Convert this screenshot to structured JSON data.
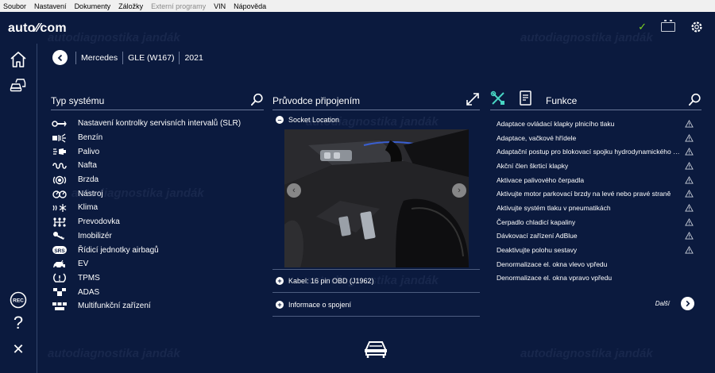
{
  "menubar": {
    "items": [
      {
        "label": "Soubor"
      },
      {
        "label": "Nastavení"
      },
      {
        "label": "Dokumenty"
      },
      {
        "label": "Záložky"
      },
      {
        "label": "Externí programy",
        "disabled": true
      },
      {
        "label": "VIN"
      },
      {
        "label": "Nápověda"
      }
    ]
  },
  "app": {
    "logo": "auto⁄⁄com",
    "status_check": "✓"
  },
  "breadcrumb": {
    "make": "Mercedes",
    "model": "GLE (W167)",
    "year": "2021"
  },
  "systems": {
    "title": "Typ systému",
    "items": [
      {
        "label": "Nastavení kontrolky servisních intervalů (SLR)",
        "icon": "wrench-icon"
      },
      {
        "label": "Benzín",
        "icon": "fuel-injector-icon"
      },
      {
        "label": "Palivo",
        "icon": "fuel-icon"
      },
      {
        "label": "Nafta",
        "icon": "diesel-icon"
      },
      {
        "label": "Brzda",
        "icon": "brake-icon"
      },
      {
        "label": "Nástroj",
        "icon": "instrument-icon"
      },
      {
        "label": "Klima",
        "icon": "climate-icon"
      },
      {
        "label": "Prevodovka",
        "icon": "gearbox-icon"
      },
      {
        "label": "Imobilizér",
        "icon": "key-icon"
      },
      {
        "label": "Řídicí jednotky airbagů",
        "icon": "srs-icon"
      },
      {
        "label": "EV",
        "icon": "ev-icon"
      },
      {
        "label": "TPMS",
        "icon": "tpms-icon"
      },
      {
        "label": "ADAS",
        "icon": "adas-icon"
      },
      {
        "label": "Multifunkční zařízení",
        "icon": "multifunction-icon"
      }
    ],
    "srs_badge": "SRS"
  },
  "guide": {
    "title": "Průvodce připojením",
    "socket_label": "Socket Location",
    "cable_label": "Kabel: 16 pin OBD (J1962)",
    "info_label": "Informace o spojení"
  },
  "functions": {
    "title": "Funkce",
    "items": [
      {
        "label": "Adaptace ovládací klapky plnicího tlaku"
      },
      {
        "label": "Adaptace, vačkové hřídele"
      },
      {
        "label": "Adaptační postup pro blokovací spojku hydrodynamického měni..."
      },
      {
        "label": "Akční člen škrticí klapky"
      },
      {
        "label": "Aktivace palivového čerpadla"
      },
      {
        "label": "Aktivujte motor parkovací brzdy na levé nebo pravé straně"
      },
      {
        "label": "Aktivujte systém tlaku v pneumatikách"
      },
      {
        "label": "Čerpadlo chladicí kapaliny"
      },
      {
        "label": "Dávkovací zařízení AdBlue"
      },
      {
        "label": "Deaktivujte polohu sestavy"
      },
      {
        "label": "Denormalizace el. okna vlevo vpředu"
      },
      {
        "label": "Denormalizace el. okna vpravo vpředu"
      }
    ],
    "next_label": "Další"
  },
  "sidebar": {
    "rec_label": "REC",
    "help_label": "?",
    "close_label": "✕"
  },
  "watermark": {
    "text": "autodiagnostika jandák"
  },
  "colors": {
    "background": "#0b1a3e",
    "accent_check": "#7ed321",
    "divider": "#6a7898"
  }
}
